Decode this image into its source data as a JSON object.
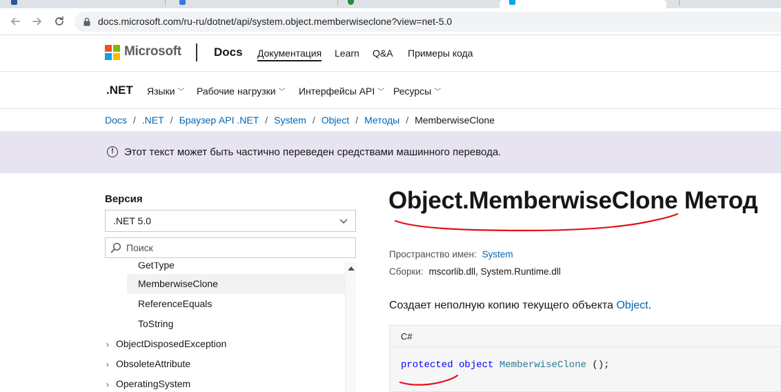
{
  "browser": {
    "url": "docs.microsoft.com/ru-ru/dotnet/api/system.object.memberwiseclone?view=net-5.0",
    "icons": {
      "back": "arrow-left-icon",
      "forward": "arrow-right-icon",
      "reload": "reload-icon",
      "lock": "lock-icon"
    }
  },
  "header": {
    "brand": "Microsoft",
    "product": "Docs",
    "links": [
      "Документация",
      "Learn",
      "Q&A",
      "Примеры кода"
    ],
    "logo_colors": [
      "#f25022",
      "#7fba00",
      "#00a4ef",
      "#ffb900"
    ]
  },
  "product_nav": {
    "brand": ".NET",
    "items": [
      "Языки",
      "Рабочие нагрузки",
      "Интерфейсы API",
      "Ресурсы"
    ]
  },
  "breadcrumb": {
    "items": [
      "Docs",
      ".NET",
      "Браузер API .NET",
      "System",
      "Object",
      "Методы"
    ],
    "current": "MemberwiseClone",
    "separator": "/"
  },
  "banner": {
    "text": "Этот текст может быть частично переведен средствами машинного перевода.",
    "icon": "info-icon",
    "background": "#e8e3f1"
  },
  "sidebar": {
    "version_label": "Версия",
    "version_value": ".NET 5.0",
    "search_placeholder": "Поиск",
    "toc": {
      "partial_item": "GetType",
      "members": [
        "MemberwiseClone",
        "ReferenceEquals",
        "ToString"
      ],
      "selected": "MemberwiseClone",
      "classes": [
        "ObjectDisposedException",
        "ObsoleteAttribute",
        "OperatingSystem"
      ]
    }
  },
  "main": {
    "title": "Object.MemberwiseClone Метод",
    "namespace_label": "Пространство имен:",
    "namespace_value": "System",
    "assemblies_label": "Сборки:",
    "assemblies_value": "mscorlib.dll, System.Runtime.dll",
    "summary_text": "Создает неполную копию текущего объекта ",
    "summary_link": "Object",
    "summary_end": ".",
    "code": {
      "lang": "C#",
      "keyword_1": "protected",
      "keyword_2": "object",
      "method": "MemberwiseClone",
      "tail": " ();"
    }
  },
  "colors": {
    "link": "#0065b3",
    "annotation_red": "#e3101a"
  }
}
